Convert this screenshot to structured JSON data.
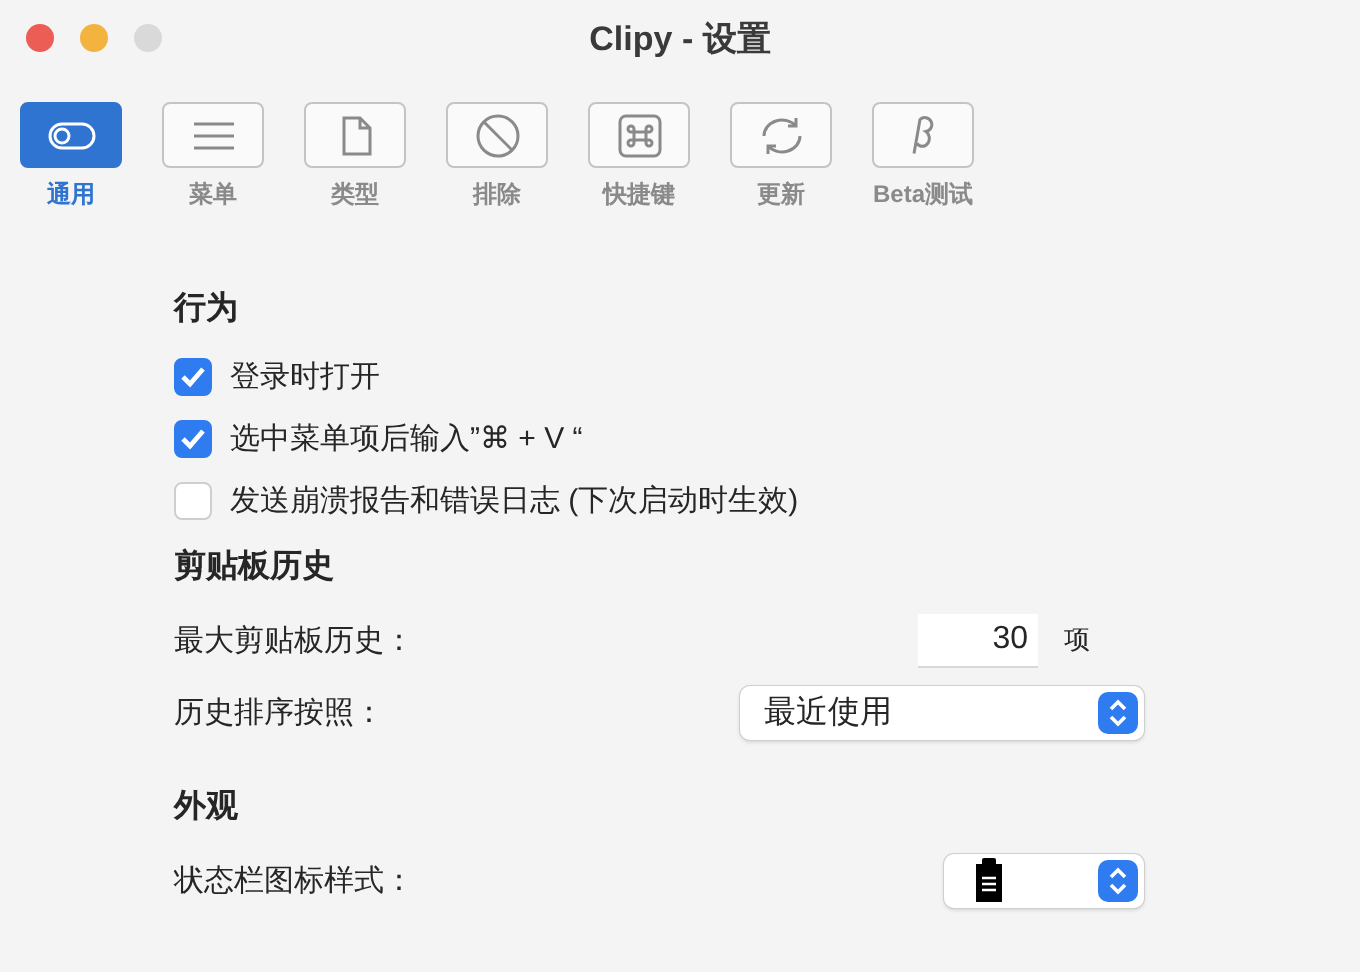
{
  "window": {
    "title": "Clipy - 设置"
  },
  "tabs": [
    {
      "label": "通用",
      "kind": "toggle",
      "selected": true
    },
    {
      "label": "菜单",
      "kind": "lines",
      "selected": false
    },
    {
      "label": "类型",
      "kind": "document",
      "selected": false
    },
    {
      "label": "排除",
      "kind": "prohibit",
      "selected": false
    },
    {
      "label": "快捷键",
      "kind": "command",
      "selected": false
    },
    {
      "label": "更新",
      "kind": "refresh",
      "selected": false
    },
    {
      "label": "Beta测试",
      "kind": "beta",
      "selected": false
    }
  ],
  "sections": [
    {
      "title": "行为",
      "rows": [
        {
          "kind": "checkbox",
          "label": "登录时打开",
          "checked": true
        },
        {
          "kind": "checkbox",
          "label": "选中菜单项后输入”⌘ + V “",
          "checked": true
        },
        {
          "kind": "checkbox",
          "label": "发送崩溃报告和错误日志 (下次启动时生效)",
          "checked": false
        }
      ]
    },
    {
      "title": "剪贴板历史",
      "rows": [
        {
          "kind": "number",
          "label": "最大剪贴板历史：",
          "value": "30",
          "unit": "项"
        },
        {
          "kind": "select",
          "label": "历史排序按照：",
          "value": "最近使用"
        }
      ]
    },
    {
      "title": "外观",
      "rows": [
        {
          "kind": "icon-select",
          "label": "状态栏图标样式："
        }
      ]
    }
  ]
}
